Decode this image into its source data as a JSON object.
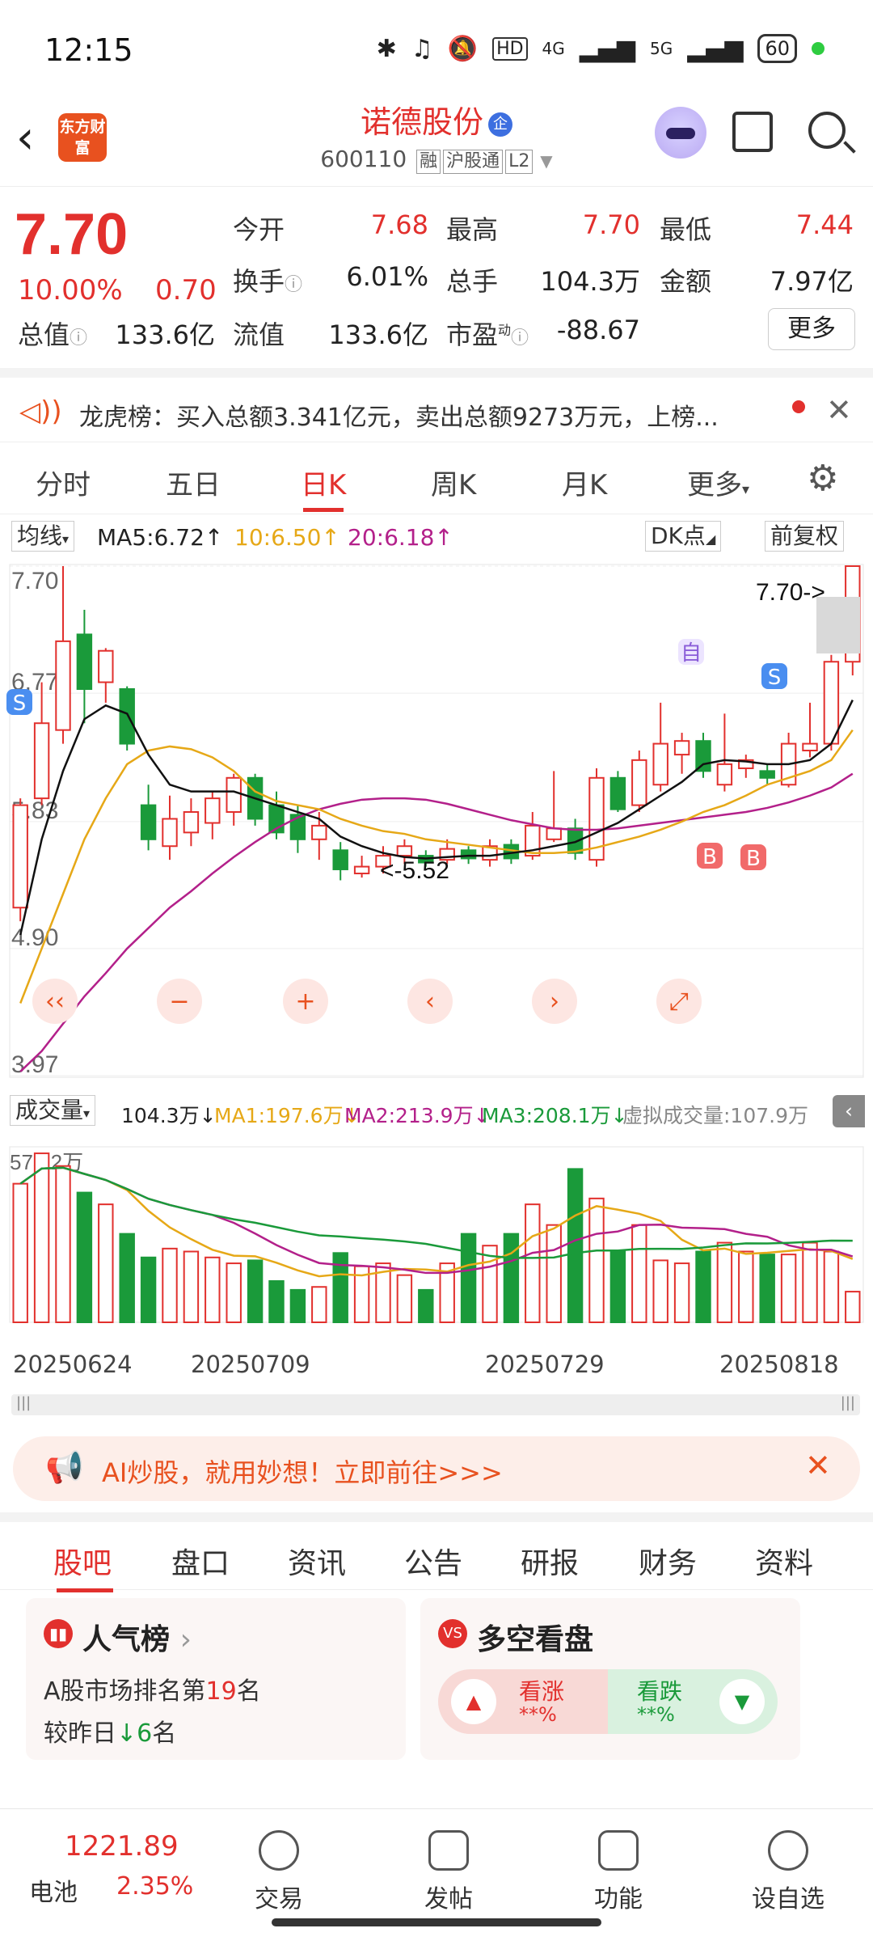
{
  "status": {
    "time": "12:15",
    "battery": "60",
    "network_1": "4G",
    "network_2": "5G",
    "hd": "HD"
  },
  "header": {
    "back_icon": "chevron-left-icon",
    "logo_text": "东方财富",
    "name": "诺德股份",
    "name_badge": "企",
    "code": "600110",
    "tags": [
      "融",
      "沪股通",
      "L2"
    ]
  },
  "quote": {
    "price": "7.70",
    "pct": "10.00%",
    "change": "0.70",
    "fields": [
      {
        "label": "今开",
        "value": "7.68"
      },
      {
        "label": "最高",
        "value": "7.70"
      },
      {
        "label": "最低",
        "value": "7.44"
      },
      {
        "label": "换手",
        "value": "6.01%"
      },
      {
        "label": "总手",
        "value": "104.3万"
      },
      {
        "label": "金额",
        "value": "7.97亿"
      },
      {
        "label": "总值",
        "value": "133.6亿"
      },
      {
        "label": "流值",
        "value": "133.6亿"
      },
      {
        "label": "市盈",
        "value": "-88.67"
      }
    ],
    "pe_sup": "动",
    "more": "更多",
    "colors": {
      "up": "#e2302d",
      "down": "#1a9a3a"
    }
  },
  "dragon": {
    "text": "龙虎榜：买入总额3.341亿元，卖出总额9273万元，上榜..."
  },
  "ktabs": [
    "分时",
    "五日",
    "日K",
    "周K",
    "月K",
    "更多"
  ],
  "ma": {
    "type": "均线",
    "ma5": "MA5:6.72",
    "ma10": "10:6.50",
    "ma20": "20:6.18",
    "dk": "DK点",
    "adjust": "前复权"
  },
  "chart_labels": {
    "y_ticks": [
      "7.70",
      "6.77",
      "5.83",
      "4.90",
      "3.97"
    ],
    "last_price_label": "7.70->",
    "low_label": "<-5.52",
    "self_marker": "自",
    "sell_marker": "S",
    "buy_marker": "B"
  },
  "volume": {
    "type": "成交量",
    "value": "104.3万",
    "ma1": "MA1:197.6万",
    "ma2": "MA2:213.9万",
    "ma3": "MA3:208.1万",
    "virtual": "虚拟成交量:107.9万",
    "max_label": "573.2万"
  },
  "dates": [
    "20250624",
    "20250709",
    "20250729",
    "20250818"
  ],
  "chart_data": {
    "type": "candlestick",
    "ylim": [
      3.97,
      7.7
    ],
    "candles": [
      {
        "o": 5.2,
        "c": 5.95,
        "h": 6.0,
        "l": 5.1
      },
      {
        "o": 6.0,
        "c": 6.55,
        "h": 6.85,
        "l": 5.95
      },
      {
        "o": 6.5,
        "c": 7.15,
        "h": 7.7,
        "l": 6.4
      },
      {
        "o": 7.2,
        "c": 6.8,
        "h": 7.38,
        "l": 6.55
      },
      {
        "o": 6.85,
        "c": 7.08,
        "h": 7.1,
        "l": 6.7
      },
      {
        "o": 6.8,
        "c": 6.4,
        "h": 6.82,
        "l": 6.35
      },
      {
        "o": 5.95,
        "c": 5.7,
        "h": 6.1,
        "l": 5.62
      },
      {
        "o": 5.65,
        "c": 5.85,
        "h": 6.02,
        "l": 5.55
      },
      {
        "o": 5.75,
        "c": 5.9,
        "h": 6.0,
        "l": 5.65
      },
      {
        "o": 5.82,
        "c": 6.0,
        "h": 6.05,
        "l": 5.7
      },
      {
        "o": 5.9,
        "c": 6.15,
        "h": 6.18,
        "l": 5.8
      },
      {
        "o": 6.15,
        "c": 5.85,
        "h": 6.18,
        "l": 5.8
      },
      {
        "o": 5.95,
        "c": 5.75,
        "h": 6.05,
        "l": 5.7
      },
      {
        "o": 5.88,
        "c": 5.7,
        "h": 5.95,
        "l": 5.6
      },
      {
        "o": 5.7,
        "c": 5.8,
        "h": 5.9,
        "l": 5.55
      },
      {
        "o": 5.62,
        "c": 5.48,
        "h": 5.68,
        "l": 5.4
      },
      {
        "o": 5.45,
        "c": 5.5,
        "h": 5.58,
        "l": 5.42
      },
      {
        "o": 5.5,
        "c": 5.58,
        "h": 5.65,
        "l": 5.45
      },
      {
        "o": 5.58,
        "c": 5.65,
        "h": 5.7,
        "l": 5.52
      },
      {
        "o": 5.58,
        "c": 5.53,
        "h": 5.62,
        "l": 5.5
      },
      {
        "o": 5.55,
        "c": 5.63,
        "h": 5.7,
        "l": 5.52
      },
      {
        "o": 5.62,
        "c": 5.56,
        "h": 5.65,
        "l": 5.52
      },
      {
        "o": 5.55,
        "c": 5.65,
        "h": 5.7,
        "l": 5.5
      },
      {
        "o": 5.66,
        "c": 5.56,
        "h": 5.7,
        "l": 5.52
      },
      {
        "o": 5.58,
        "c": 5.8,
        "h": 5.9,
        "l": 5.55
      },
      {
        "o": 5.7,
        "c": 5.78,
        "h": 6.2,
        "l": 5.68
      },
      {
        "o": 5.78,
        "c": 5.6,
        "h": 5.85,
        "l": 5.55
      },
      {
        "o": 5.55,
        "c": 6.15,
        "h": 6.22,
        "l": 5.5
      },
      {
        "o": 6.15,
        "c": 5.92,
        "h": 6.2,
        "l": 5.9
      },
      {
        "o": 5.95,
        "c": 6.28,
        "h": 6.35,
        "l": 5.9
      },
      {
        "o": 6.1,
        "c": 6.4,
        "h": 6.7,
        "l": 6.05
      },
      {
        "o": 6.32,
        "c": 6.42,
        "h": 6.48,
        "l": 6.18
      },
      {
        "o": 6.42,
        "c": 6.2,
        "h": 6.48,
        "l": 6.15
      },
      {
        "o": 6.1,
        "c": 6.25,
        "h": 6.62,
        "l": 6.05
      },
      {
        "o": 6.22,
        "c": 6.28,
        "h": 6.32,
        "l": 6.15
      },
      {
        "o": 6.2,
        "c": 6.15,
        "h": 6.25,
        "l": 6.1
      },
      {
        "o": 6.1,
        "c": 6.4,
        "h": 6.48,
        "l": 6.08
      },
      {
        "o": 6.35,
        "c": 6.4,
        "h": 6.7,
        "l": 6.3
      },
      {
        "o": 6.4,
        "c": 7.0,
        "h": 7.05,
        "l": 6.35
      },
      {
        "o": 7.0,
        "c": 7.7,
        "h": 7.7,
        "l": 6.9
      }
    ],
    "ma5": [
      5.0,
      5.7,
      6.2,
      6.58,
      6.68,
      6.62,
      6.32,
      6.1,
      6.05,
      6.05,
      6.05,
      6.0,
      5.95,
      5.9,
      5.85,
      5.72,
      5.65,
      5.6,
      5.57,
      5.56,
      5.57,
      5.58,
      5.58,
      5.6,
      5.62,
      5.65,
      5.68,
      5.75,
      5.82,
      5.92,
      6.02,
      6.12,
      6.25,
      6.28,
      6.27,
      6.25,
      6.25,
      6.28,
      6.4,
      6.72
    ],
    "ma10": [
      4.5,
      4.9,
      5.3,
      5.7,
      6.0,
      6.25,
      6.35,
      6.38,
      6.36,
      6.3,
      6.2,
      6.05,
      5.98,
      5.95,
      5.92,
      5.85,
      5.8,
      5.76,
      5.74,
      5.7,
      5.68,
      5.66,
      5.64,
      5.62,
      5.6,
      5.6,
      5.61,
      5.64,
      5.68,
      5.72,
      5.77,
      5.83,
      5.9,
      5.95,
      6.02,
      6.1,
      6.15,
      6.2,
      6.28,
      6.5
    ],
    "ma20": [
      4.0,
      4.15,
      4.35,
      4.55,
      4.72,
      4.9,
      5.05,
      5.2,
      5.32,
      5.45,
      5.57,
      5.68,
      5.78,
      5.86,
      5.92,
      5.96,
      5.99,
      6.0,
      6.0,
      5.99,
      5.96,
      5.92,
      5.88,
      5.84,
      5.81,
      5.78,
      5.77,
      5.77,
      5.78,
      5.8,
      5.82,
      5.84,
      5.86,
      5.88,
      5.9,
      5.93,
      5.97,
      6.02,
      6.08,
      6.18
    ],
    "volume_wan": [
      470,
      573,
      530,
      440,
      400,
      300,
      220,
      250,
      240,
      220,
      200,
      210,
      140,
      110,
      120,
      235,
      190,
      200,
      160,
      110,
      200,
      300,
      260,
      300,
      400,
      330,
      520,
      420,
      240,
      330,
      210,
      200,
      240,
      270,
      240,
      230,
      230,
      270,
      240,
      104
    ]
  }
}
